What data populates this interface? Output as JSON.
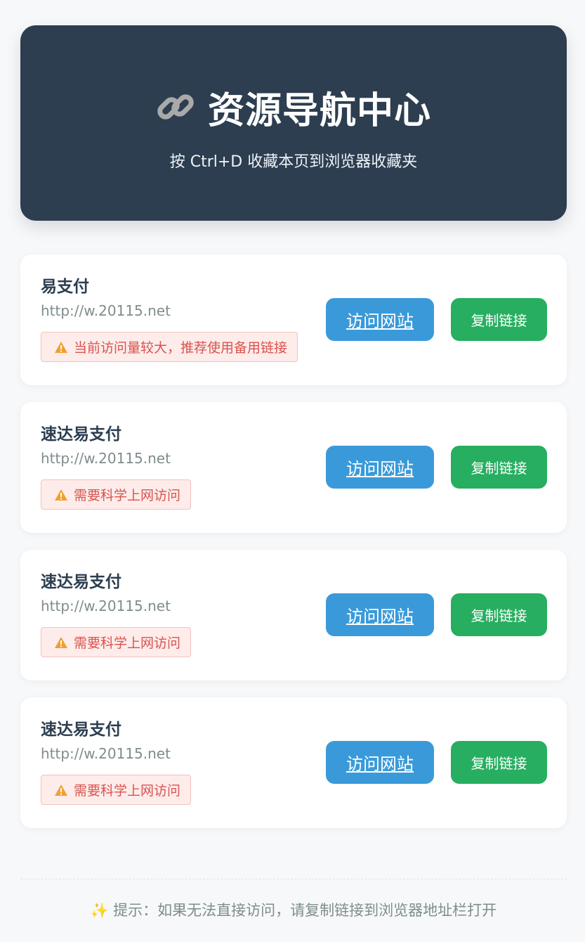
{
  "header": {
    "title": "资源导航中心",
    "subtitle": "按 Ctrl+D 收藏本页到浏览器收藏夹",
    "icon": "link-icon"
  },
  "cards": [
    {
      "name": "易支付",
      "url": "http://w.20115.net",
      "warning": "当前访问量较大，推荐使用备用链接",
      "visit_label": "访问网站",
      "copy_label": "复制链接"
    },
    {
      "name": "速达易支付",
      "url": "http://w.20115.net",
      "warning": "需要科学上网访问",
      "visit_label": "访问网站",
      "copy_label": "复制链接"
    },
    {
      "name": "速达易支付",
      "url": "http://w.20115.net",
      "warning": "需要科学上网访问",
      "visit_label": "访问网站",
      "copy_label": "复制链接"
    },
    {
      "name": "速达易支付",
      "url": "http://w.20115.net",
      "warning": "需要科学上网访问",
      "visit_label": "访问网站",
      "copy_label": "复制链接"
    }
  ],
  "footer": {
    "text": "提示：如果无法直接访问，请复制链接到浏览器地址栏打开",
    "icon": "sparkles-icon"
  },
  "colors": {
    "header_bg": "#2c3e50",
    "visit_button": "#3a9ad9",
    "copy_button": "#27ae60",
    "warning_text": "#d9534f",
    "warning_bg": "#fdecea"
  }
}
